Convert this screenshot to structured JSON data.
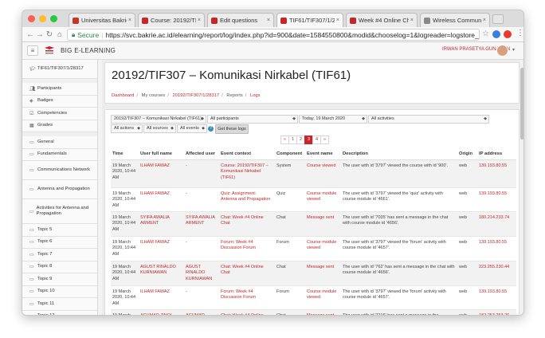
{
  "browser": {
    "tabs": [
      {
        "label": "Universitas Bakrie - ",
        "color": "#c0392b",
        "active": false
      },
      {
        "label": "Course: 20192/TIF30",
        "color": "#c3272b",
        "active": false
      },
      {
        "label": "Edit questions",
        "color": "#c3272b",
        "active": false
      },
      {
        "label": "TIF61/TIF307/1/283",
        "color": "#c3272b",
        "active": true
      },
      {
        "label": "Week #4 Online Cha",
        "color": "#c3272b",
        "active": false
      },
      {
        "label": "Wireless Communica",
        "color": "#888888",
        "active": false
      }
    ],
    "secure_label": "Secure",
    "url": "https://svc.bakrie.ac.id/elearning/report/log/index.php?id=900&date=1584550800&modid&chooselog=1&logreader=logstore_standard..."
  },
  "header": {
    "brand": "BIG E-LEARNING",
    "user_name": "IRWAN PRASETYA GUNAWAN"
  },
  "sidebar": {
    "items": [
      {
        "label": "TIF61/TIF307/1/28317",
        "icon": "graduation-cap-icon"
      },
      {
        "label": "Participants",
        "icon": "users-icon"
      },
      {
        "label": "Badges",
        "icon": "badge-icon"
      },
      {
        "label": "Competencies",
        "icon": "checkbox-icon"
      },
      {
        "label": "Grades",
        "icon": "table-icon"
      },
      {
        "label": "General",
        "icon": "folder-icon"
      },
      {
        "label": "Fundamentals",
        "icon": "folder-icon"
      },
      {
        "label": "Communications Network",
        "icon": "folder-icon"
      },
      {
        "label": "Antenna and Propagation",
        "icon": "folder-icon"
      },
      {
        "label": "Activities for Antenna and Propagation",
        "icon": "folder-icon"
      },
      {
        "label": "Topic 5",
        "icon": "folder-icon"
      },
      {
        "label": "Topic 6",
        "icon": "folder-icon"
      },
      {
        "label": "Topic 7",
        "icon": "folder-icon"
      },
      {
        "label": "Topic 8",
        "icon": "folder-icon"
      },
      {
        "label": "Topic 9",
        "icon": "folder-icon"
      },
      {
        "label": "Topic 10",
        "icon": "folder-icon"
      },
      {
        "label": "Topic 11",
        "icon": "folder-icon"
      },
      {
        "label": "Topic 12",
        "icon": "folder-icon"
      }
    ]
  },
  "page": {
    "title": "20192/TIF307 – Komunikasi Nirkabel (TIF61)",
    "breadcrumb": [
      "Dashboard",
      "My courses",
      "20192/TIF307/1/28317",
      "Reports",
      "Logs"
    ]
  },
  "filters": {
    "course": "20192/TIF307 – Komunikasi Nirkabel (TIF61)",
    "participants": "All participants",
    "date": "Today, 19 March 2020",
    "activities": "All activities",
    "actions": "All actions",
    "sources": "All sources",
    "events": "All events",
    "button": "Get these logs"
  },
  "pager": {
    "prev": "«",
    "pages": [
      "1",
      "2",
      "3",
      "4"
    ],
    "current": "3",
    "next": "»"
  },
  "table": {
    "headers": [
      "Time",
      "User full name",
      "Affected user",
      "Event context",
      "Component",
      "Event name",
      "Description",
      "Origin",
      "IP address"
    ],
    "rows": [
      {
        "time": "19 March 2020, 10:44 AM",
        "user": "ILHAM FAWAZ",
        "affected": "-",
        "context": "Course: 20192/TIF307 – Komunikasi Nirkabel (TIF61)",
        "component": "System",
        "event": "Course viewed",
        "description": "The user with id '3797' viewed the course with id '900'.",
        "origin": "web",
        "ip": "139.193.80.55"
      },
      {
        "time": "19 March 2020, 10:44 AM",
        "user": "ILHAM FAWAZ",
        "affected": "-",
        "context": "Quiz: Assignment: Antenna and Propagation",
        "component": "Quiz",
        "event": "Course module viewed",
        "description": "The user with id '3797' viewed the 'quiz' activity with course module id '4661'.",
        "origin": "web",
        "ip": "139.193.80.55"
      },
      {
        "time": "19 March 2020, 10:44 AM",
        "user": "SYIFA AWALIA ARMENT",
        "affected": "SYIFA AWALIA ARMENT",
        "context": "Chat: Week #4 Online Chat",
        "component": "Chat",
        "event": "Message sent",
        "description": "The user with id '7035' has sent a message in the chat with course module id '4656'.",
        "origin": "web",
        "ip": "180.214.233.74"
      },
      {
        "time": "19 March 2020, 10:44 AM",
        "user": "ILHAM FAWAZ",
        "affected": "-",
        "context": "Forum: Week #4 Discussion Forum",
        "component": "Forum",
        "event": "Course module viewed",
        "description": "The user with id '3797' viewed the 'forum' activity with course module id '4657'.",
        "origin": "web",
        "ip": "139.193.80.55"
      },
      {
        "time": "19 March 2020, 10:44 AM",
        "user": "AGUST RINALDO KURNIAWAN",
        "affected": "AGUST RINALDO KURNIAWAN",
        "context": "Chat: Week #4 Online Chat",
        "component": "Chat",
        "event": "Message sent",
        "description": "The user with id '762' has sent a message in the chat with course module id '4656'.",
        "origin": "web",
        "ip": "223.255.230.44"
      },
      {
        "time": "19 March 2020, 10:44 AM",
        "user": "ILHAM FAWAZ",
        "affected": "-",
        "context": "Forum: Week #4 Discussion Forum",
        "component": "Forum",
        "event": "Course module viewed",
        "description": "The user with id '3797' viewed the 'forum' activity with course module id '4657'.",
        "origin": "web",
        "ip": "139.193.80.55"
      },
      {
        "time": "19 March",
        "user": "ACHMAD ZAKY",
        "affected": "ACHMAD",
        "context": "Chat: Week #4 Online",
        "component": "Chat",
        "event": "Message sent",
        "description": "The user with id '7216' has sent a message in the",
        "origin": "web",
        "ip": "182.253.253.26"
      }
    ]
  },
  "colors": {
    "accent": "#c3272b"
  }
}
